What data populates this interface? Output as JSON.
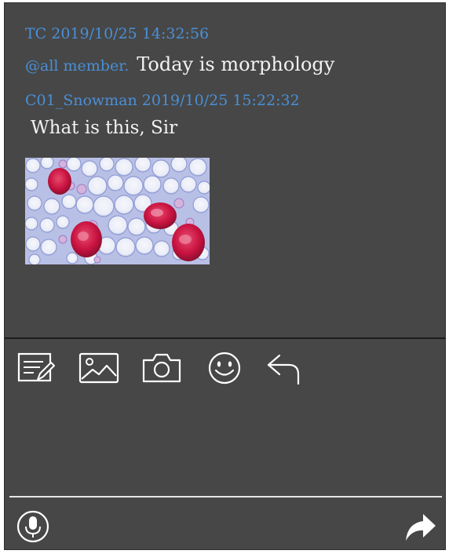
{
  "chat": {
    "messages": [
      {
        "sender": "TC",
        "timestamp": "2019/10/25 14:32:56",
        "header": "TC 2019/10/25 14:32:56",
        "mention": "@all member.",
        "text": "Today is morphology"
      },
      {
        "sender": "C01_Snowman",
        "timestamp": "2019/10/25 15:22:32",
        "header": "C01_Snowman 2019/10/25 15:22:32",
        "text": "What is this, Sir",
        "attachment": "microscope-image"
      }
    ]
  },
  "toolbar": {
    "icons": [
      "note-edit-icon",
      "image-icon",
      "camera-icon",
      "emoji-icon",
      "back-arrow-icon"
    ]
  },
  "footer": {
    "left_icon": "microphone-icon",
    "right_icon": "send-arrow-icon"
  },
  "colors": {
    "panel_bg": "#474747",
    "meta_text": "#4a8fd6",
    "message_text": "#f2f2f2",
    "icon": "#ffffff"
  }
}
